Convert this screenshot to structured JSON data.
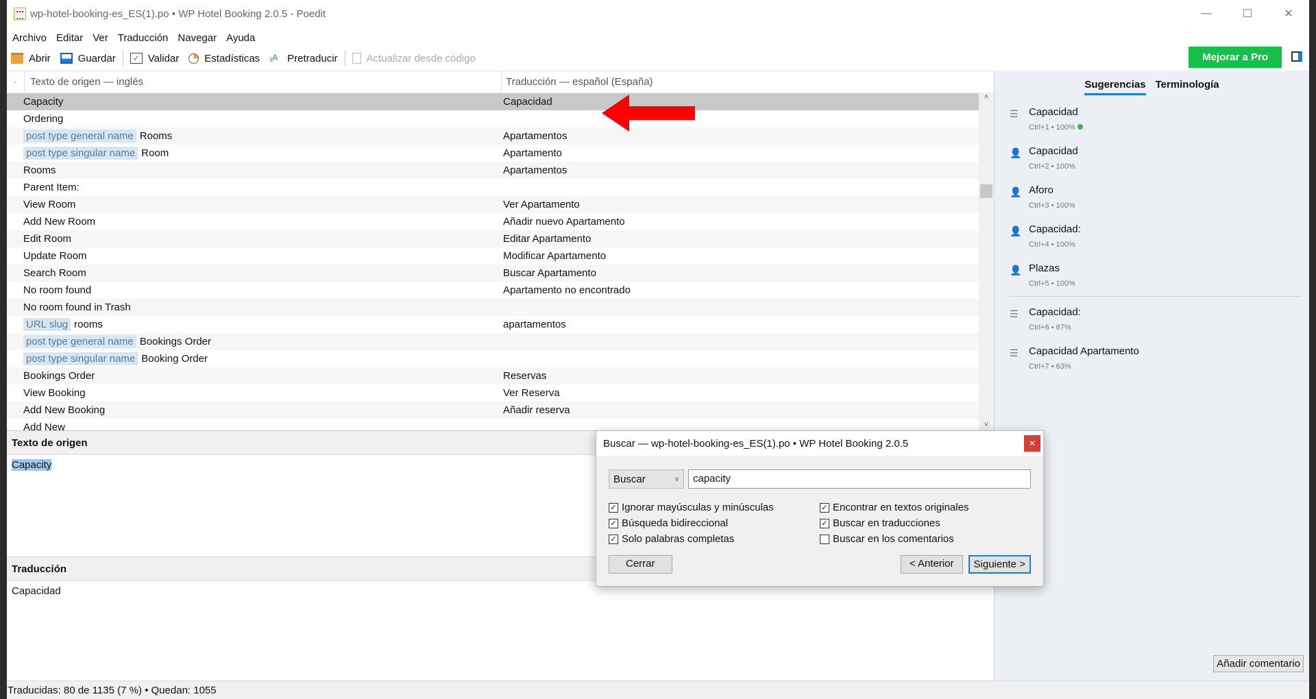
{
  "window": {
    "title": "wp-hotel-booking-es_ES(1).po • WP Hotel Booking 2.0.5 - Poedit"
  },
  "menu": [
    "Archivo",
    "Editar",
    "Ver",
    "Traducción",
    "Navegar",
    "Ayuda"
  ],
  "toolbar": {
    "open": "Abrir",
    "save": "Guardar",
    "validate": "Validar",
    "stats": "Estadísticas",
    "pretranslate": "Pretraducir",
    "update": "Actualizar desde código",
    "pro": "Mejorar a Pro"
  },
  "list": {
    "source_header": "Texto de origen — inglés",
    "translation_header": "Traducción — español (España)",
    "rows": [
      {
        "ctx": "",
        "src": "Capacity",
        "tr": "Capacidad"
      },
      {
        "ctx": "",
        "src": "Ordering",
        "tr": ""
      },
      {
        "ctx": "post type general name",
        "src": "Rooms",
        "tr": "Apartamentos"
      },
      {
        "ctx": "post type singular name",
        "src": "Room",
        "tr": "Apartamento"
      },
      {
        "ctx": "",
        "src": "Rooms",
        "tr": "Apartamentos"
      },
      {
        "ctx": "",
        "src": "Parent Item:",
        "tr": ""
      },
      {
        "ctx": "",
        "src": "View Room",
        "tr": "Ver Apartamento"
      },
      {
        "ctx": "",
        "src": "Add New Room",
        "tr": "Añadir nuevo Apartamento"
      },
      {
        "ctx": "",
        "src": "Edit Room",
        "tr": "Editar Apartamento"
      },
      {
        "ctx": "",
        "src": "Update Room",
        "tr": "Modificar Apartamento"
      },
      {
        "ctx": "",
        "src": "Search Room",
        "tr": "Buscar Apartamento"
      },
      {
        "ctx": "",
        "src": "No room found",
        "tr": "Apartamento no encontrado"
      },
      {
        "ctx": "",
        "src": "No room found in Trash",
        "tr": ""
      },
      {
        "ctx": "URL slug",
        "src": "rooms",
        "tr": "apartamentos"
      },
      {
        "ctx": "post type general name",
        "src": "Bookings Order",
        "tr": ""
      },
      {
        "ctx": "post type singular name",
        "src": "Booking Order",
        "tr": ""
      },
      {
        "ctx": "",
        "src": "Bookings Order",
        "tr": "Reservas"
      },
      {
        "ctx": "",
        "src": "View Booking",
        "tr": "Ver Reserva"
      },
      {
        "ctx": "",
        "src": "Add New Booking",
        "tr": "Añadir reserva"
      },
      {
        "ctx": "",
        "src": "Add New",
        "tr": ""
      }
    ]
  },
  "source_pane": {
    "label": "Texto de origen",
    "text": "Capacity"
  },
  "translation_pane": {
    "label": "Traducción",
    "text": "Capacidad"
  },
  "status": "Traducidas: 80 de 1135 (7 %)  •  Quedan: 1055",
  "sidebar": {
    "tabs": [
      "Sugerencias",
      "Terminología"
    ],
    "suggestions": [
      {
        "icon": "database",
        "text": "Capacidad",
        "meta": "Ctrl+1 • 100%",
        "ok": true
      },
      {
        "icon": "user",
        "text": "Capacidad",
        "meta": "Ctrl+2 • 100%"
      },
      {
        "icon": "user",
        "text": "Aforo",
        "meta": "Ctrl+3 • 100%"
      },
      {
        "icon": "user",
        "text": "Capacidad:",
        "meta": "Ctrl+4 • 100%"
      },
      {
        "icon": "user",
        "text": "Plazas",
        "meta": "Ctrl+5 • 100%"
      },
      {
        "icon": "database",
        "text": "Capacidad:",
        "meta": "Ctrl+6 • 87%"
      },
      {
        "icon": "database",
        "text": "Capacidad Apartamento",
        "meta": "Ctrl+7 • 63%"
      }
    ],
    "add_comment": "Añadir comentario"
  },
  "dialog": {
    "title": "Buscar — wp-hotel-booking-es_ES(1).po • WP Hotel Booking 2.0.5",
    "mode": "Buscar",
    "query": "capacity",
    "options_left": [
      {
        "label": "Ignorar mayúsculas y minúsculas",
        "checked": true
      },
      {
        "label": "Búsqueda bidireccional",
        "checked": true
      },
      {
        "label": "Solo palabras completas",
        "checked": true
      }
    ],
    "options_right": [
      {
        "label": "Encontrar en textos originales",
        "checked": true
      },
      {
        "label": "Buscar en traducciones",
        "checked": true
      },
      {
        "label": "Buscar en los comentarios",
        "checked": false
      }
    ],
    "close": "Cerrar",
    "prev": "< Anterior",
    "next": "Siguiente >"
  }
}
